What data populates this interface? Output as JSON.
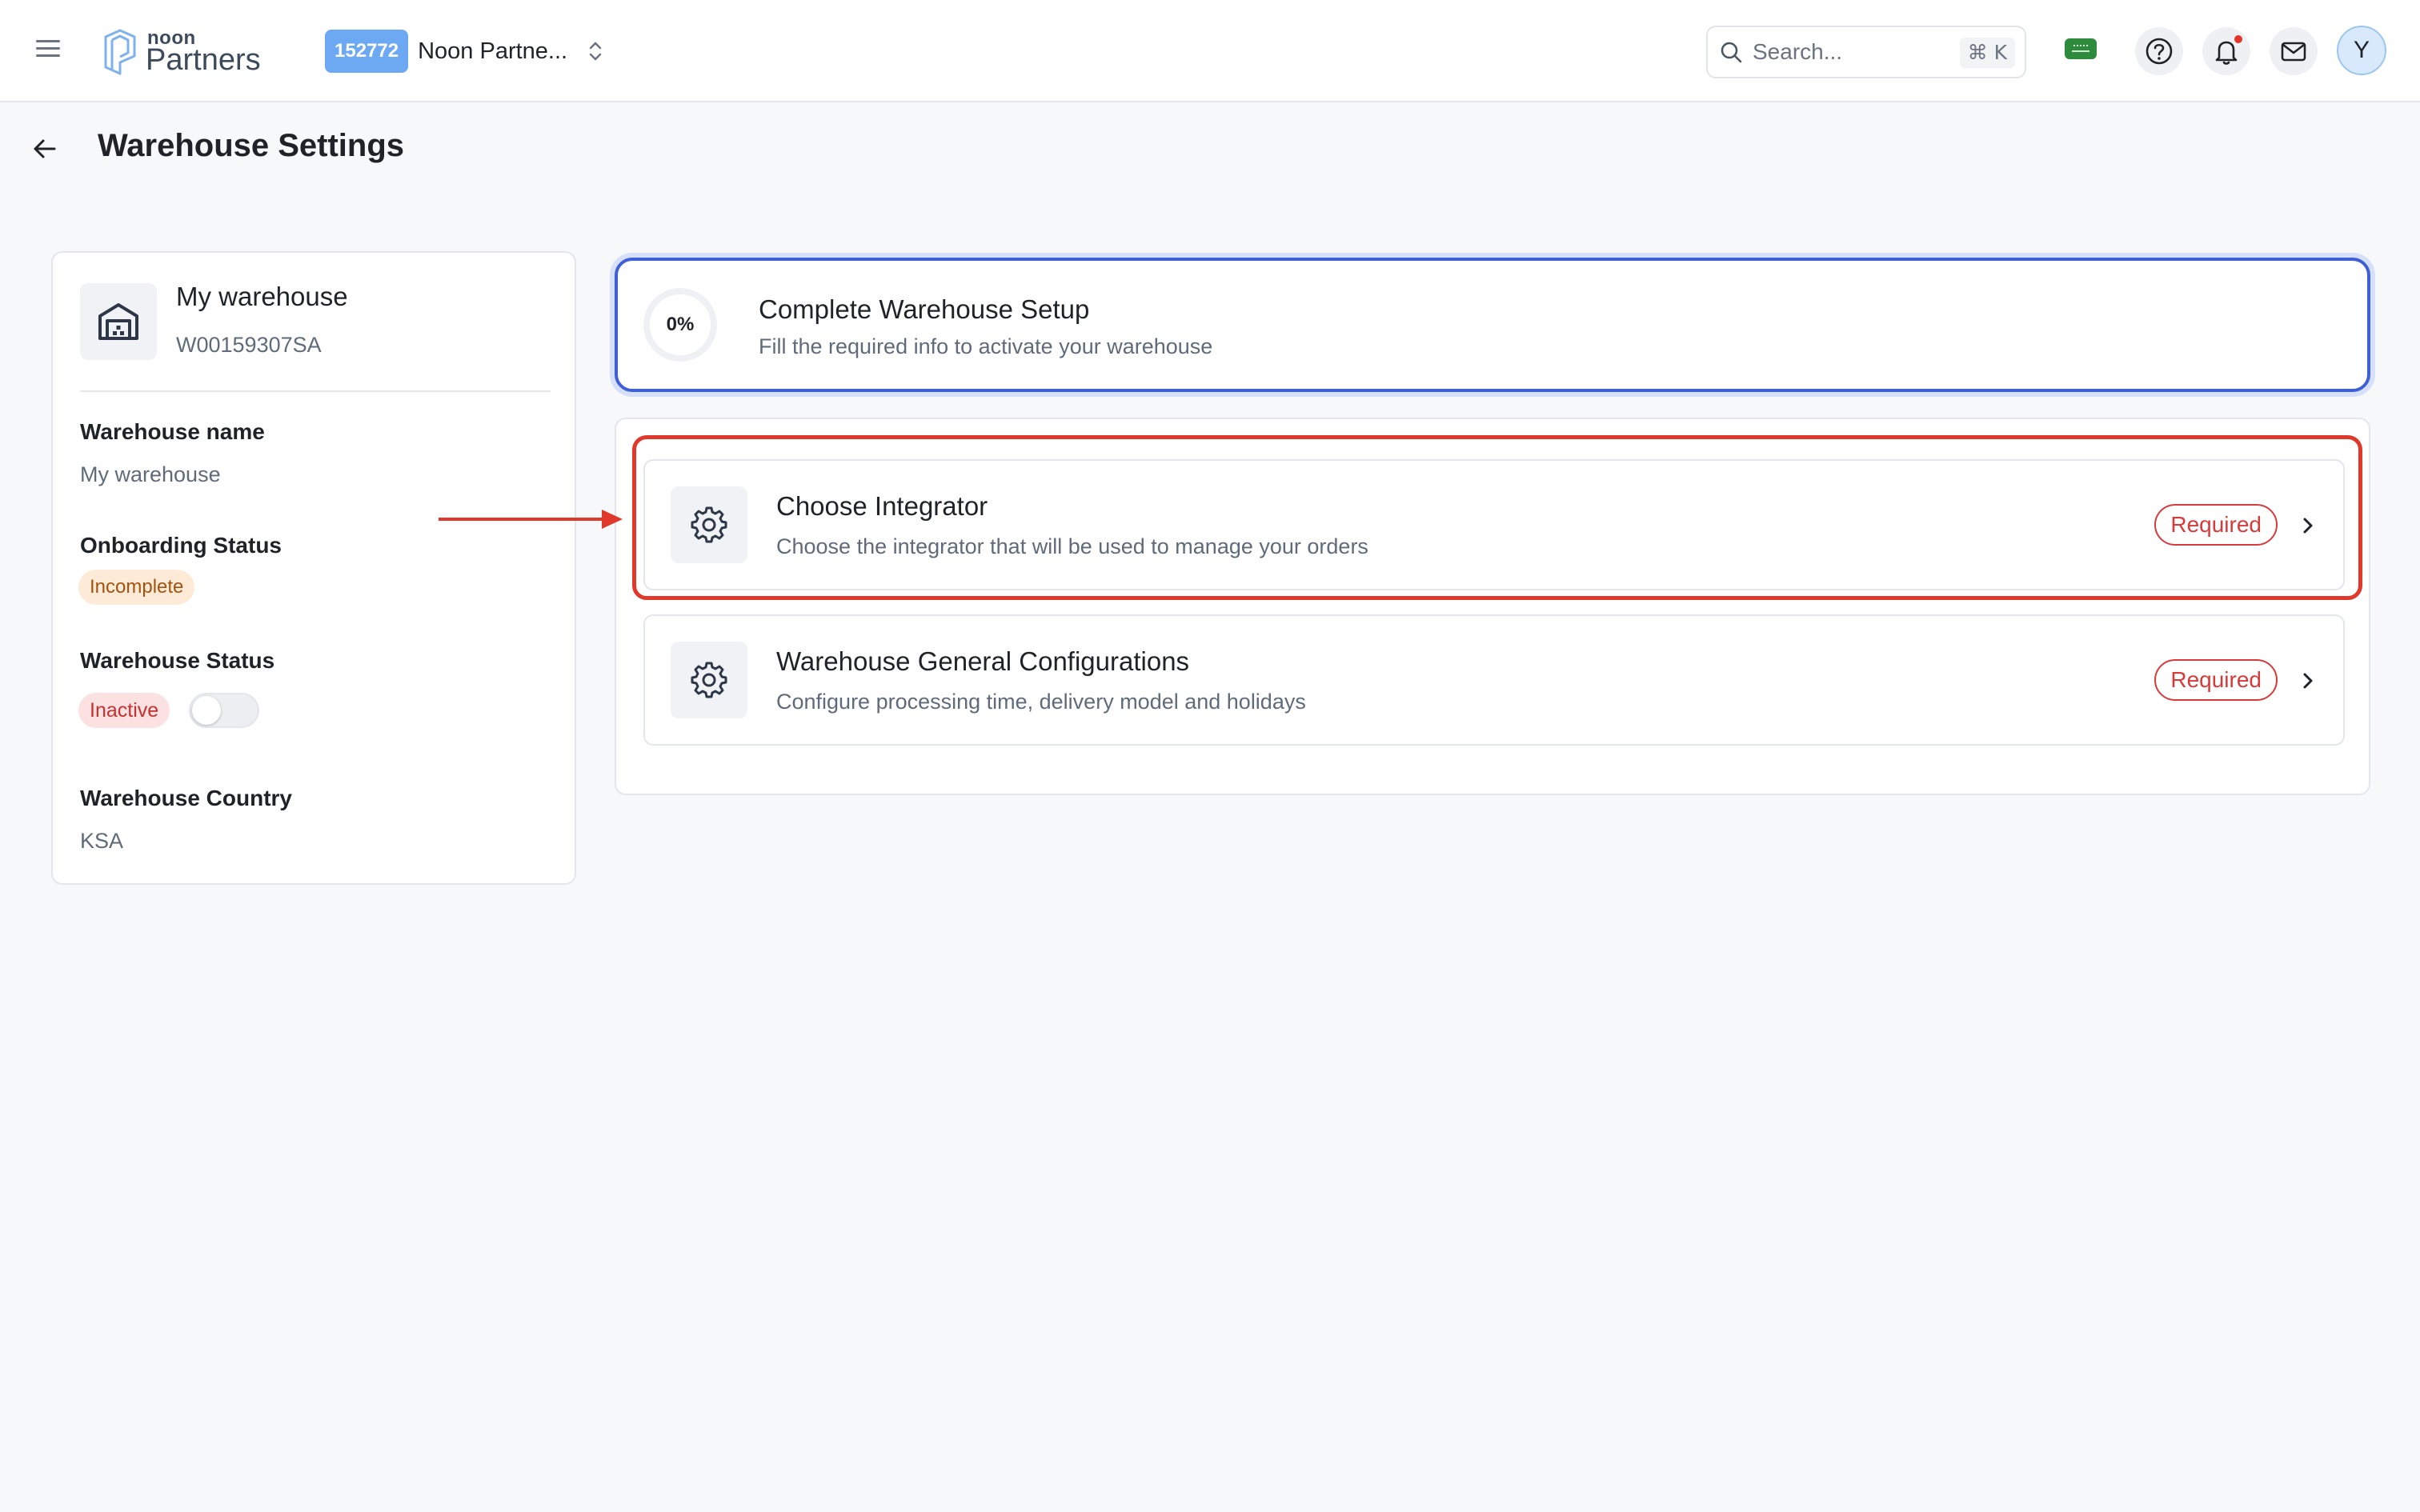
{
  "topbar": {
    "logo_small": "noon",
    "logo_large": "Partners",
    "account_id": "152772",
    "account_name": "Noon Partne...",
    "search_placeholder": "Search...",
    "search_shortcut": "⌘ K",
    "avatar_initial": "Y"
  },
  "page": {
    "title": "Warehouse Settings"
  },
  "warehouse": {
    "name": "My warehouse",
    "code": "W00159307SA",
    "fields": {
      "name_label": "Warehouse name",
      "name_value": "My warehouse",
      "onboarding_label": "Onboarding Status",
      "onboarding_value": "Incomplete",
      "status_label": "Warehouse Status",
      "status_value": "Inactive",
      "status_enabled": false,
      "country_label": "Warehouse Country",
      "country_value": "KSA"
    }
  },
  "setup": {
    "progress_label": "0%",
    "progress_fraction": 0,
    "title": "Complete Warehouse Setup",
    "subtitle": "Fill the required info to activate your warehouse"
  },
  "tasks": [
    {
      "title": "Choose Integrator",
      "subtitle": "Choose the integrator that will be used to manage your orders",
      "badge": "Required"
    },
    {
      "title": "Warehouse General Configurations",
      "subtitle": "Configure processing time, delivery model and holidays",
      "badge": "Required"
    }
  ],
  "colors": {
    "accent": "#3f5fd6",
    "required": "#d63a3a",
    "annotation": "#e0392b",
    "account_badge": "#6da8f2"
  },
  "icons": {
    "menu": "hamburger-icon",
    "logo": "noon-partners-logo",
    "search": "search-icon",
    "region": "saudi-flag-icon",
    "help": "help-icon",
    "notifications": "bell-icon",
    "mail": "mail-icon",
    "back": "back-arrow-icon",
    "warehouse": "warehouse-icon",
    "task": "gear-icon",
    "chevron": "chevron-right-icon"
  }
}
